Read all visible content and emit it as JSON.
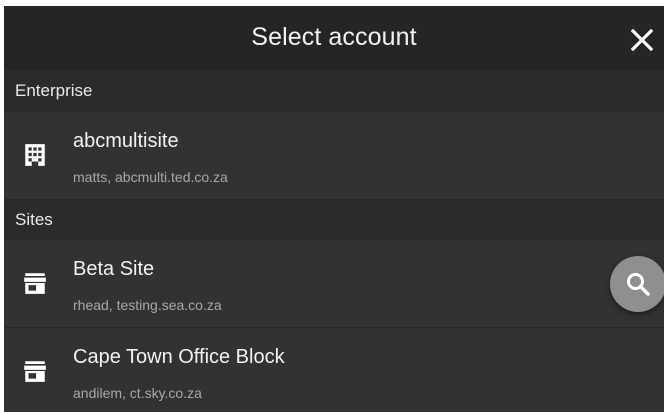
{
  "header": {
    "title": "Select account",
    "close_icon": "close-icon"
  },
  "sections": [
    {
      "label": "Enterprise",
      "items": [
        {
          "name": "abcmultisite",
          "subtitle": "matts, abcmulti.ted.co.za",
          "icon": "building-icon"
        }
      ]
    },
    {
      "label": "Sites",
      "items": [
        {
          "name": "Beta Site",
          "subtitle": "rhead, testing.sea.co.za",
          "icon": "store-icon"
        },
        {
          "name": "Cape Town Office Block",
          "subtitle": "andilem, ct.sky.co.za",
          "icon": "store-icon"
        }
      ]
    }
  ],
  "fab": {
    "icon": "search-icon"
  },
  "colors": {
    "background": "#2b2b2b",
    "header": "#252525",
    "item_background": "#323232",
    "fab": "#8f8f8f",
    "text_primary": "#f2f2f2",
    "text_secondary": "#a8a8a8"
  }
}
